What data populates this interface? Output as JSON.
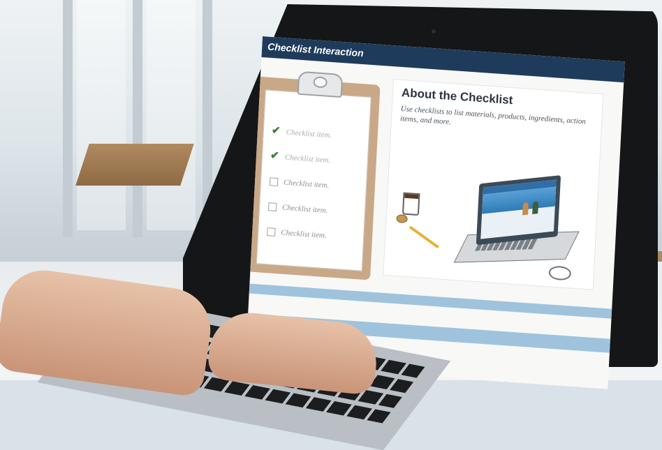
{
  "screen": {
    "title": "Checklist Interaction",
    "checklist": {
      "items": [
        {
          "label": "Checklist item.",
          "checked": true
        },
        {
          "label": "Checklist item.",
          "checked": true
        },
        {
          "label": "Checklist item.",
          "checked": false
        },
        {
          "label": "Checklist item.",
          "checked": false
        },
        {
          "label": "Checklist item.",
          "checked": false
        }
      ]
    },
    "panel": {
      "title": "About the Checklist",
      "description": "Use checklists to list materials, products, ingredients, action items, and more."
    }
  },
  "colors": {
    "title_bar": "#1f3b5c",
    "check_accent": "#3a7d32",
    "clipboard": "#c9a888",
    "footer_band": "#9fc3dd"
  },
  "icons": {
    "checkmark": "check-icon",
    "clip": "clipboard-clip-icon"
  }
}
